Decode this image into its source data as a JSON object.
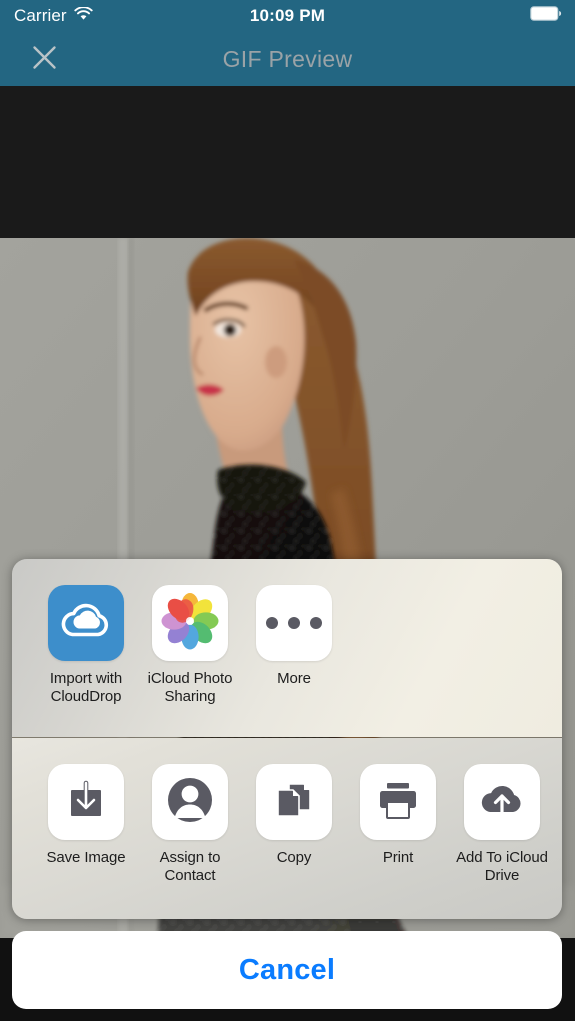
{
  "status_bar": {
    "carrier": "Carrier",
    "wifi_icon": "wifi-icon",
    "time": "10:09 PM",
    "battery_icon": "battery-full-icon",
    "background_color": "#236682",
    "text_color": "#ffffff"
  },
  "nav_bar": {
    "close_icon": "close-x-icon",
    "title": "GIF Preview",
    "title_color": "#9aa3a7",
    "background_color": "#236682"
  },
  "preview": {
    "letterbox_color": "#1a1a1a",
    "image_description": "Portrait of a woman with a ponytail in a black sequined turtleneck against a light gray wall"
  },
  "share_sheet": {
    "apps_row": [
      {
        "label": "Import with CloudDrop",
        "icon": "cloud-drop-icon",
        "icon_color": "#3d8ecb"
      },
      {
        "label": "iCloud Photo Sharing",
        "icon": "photos-pinwheel-icon"
      },
      {
        "label": "More",
        "icon": "ellipsis-icon"
      }
    ],
    "actions_row": [
      {
        "label": "Save Image",
        "icon": "save-image-icon"
      },
      {
        "label": "Assign to Contact",
        "icon": "contact-person-icon"
      },
      {
        "label": "Copy",
        "icon": "copy-documents-icon"
      },
      {
        "label": "Print",
        "icon": "printer-icon"
      },
      {
        "label": "Add To iCloud Drive",
        "icon": "cloud-upload-icon"
      }
    ],
    "icon_tint": "#5a5a63",
    "tile_color": "#ffffff"
  },
  "cancel_button": {
    "label": "Cancel",
    "text_color": "#0a7cff",
    "background_color": "#ffffff"
  }
}
